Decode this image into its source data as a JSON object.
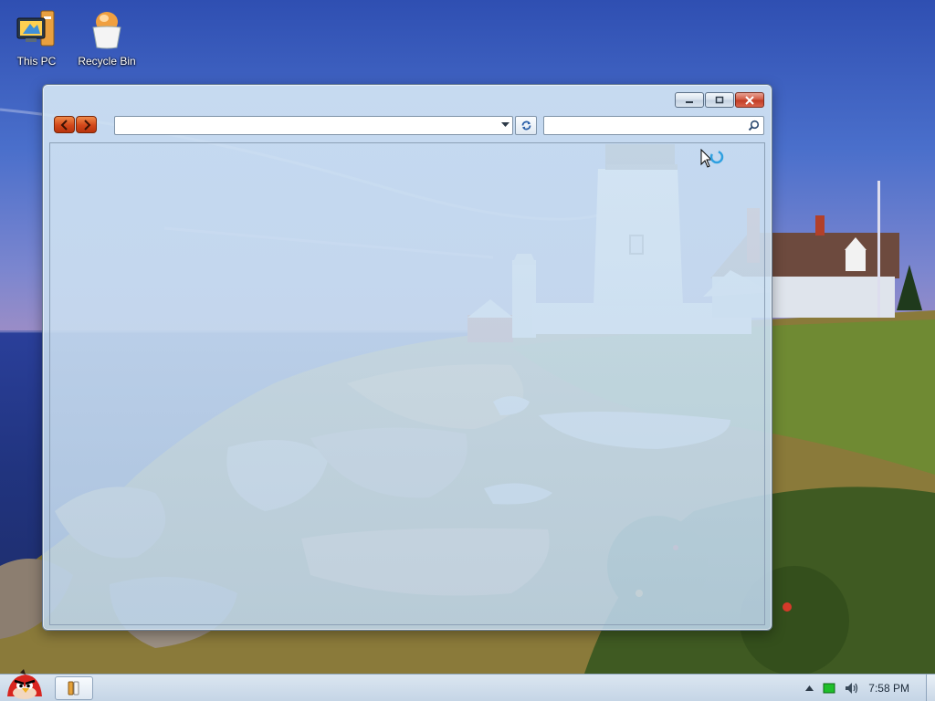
{
  "desktop": {
    "icons": [
      {
        "label": "This PC",
        "icon": "computer-icon"
      },
      {
        "label": "Recycle Bin",
        "icon": "recycle-bin-icon"
      }
    ],
    "wallpaper": "lighthouse-coast"
  },
  "window": {
    "address": {
      "value": "",
      "placeholder": ""
    },
    "search": {
      "value": "",
      "placeholder": ""
    },
    "buttons": {
      "minimize": "minimize-icon",
      "restore": "restore-icon",
      "close": "close-icon",
      "back": "back-arrow-icon",
      "forward": "forward-arrow-icon",
      "refresh": "refresh-icon"
    }
  },
  "taskbar": {
    "start_icon": "angry-bird-start-icon",
    "pinned_item_icon": "file-explorer-icon",
    "tray": {
      "show_hidden_icon": "chevron-up-icon",
      "network_icon": "green-status-icon",
      "volume_icon": "volume-icon",
      "time": "7:58 PM"
    }
  },
  "colors": {
    "close_button": "#c9442b",
    "nav_buttons": "#d2471a",
    "taskbar": "#c5d5e6",
    "window_frame": "#c3d7eb"
  }
}
